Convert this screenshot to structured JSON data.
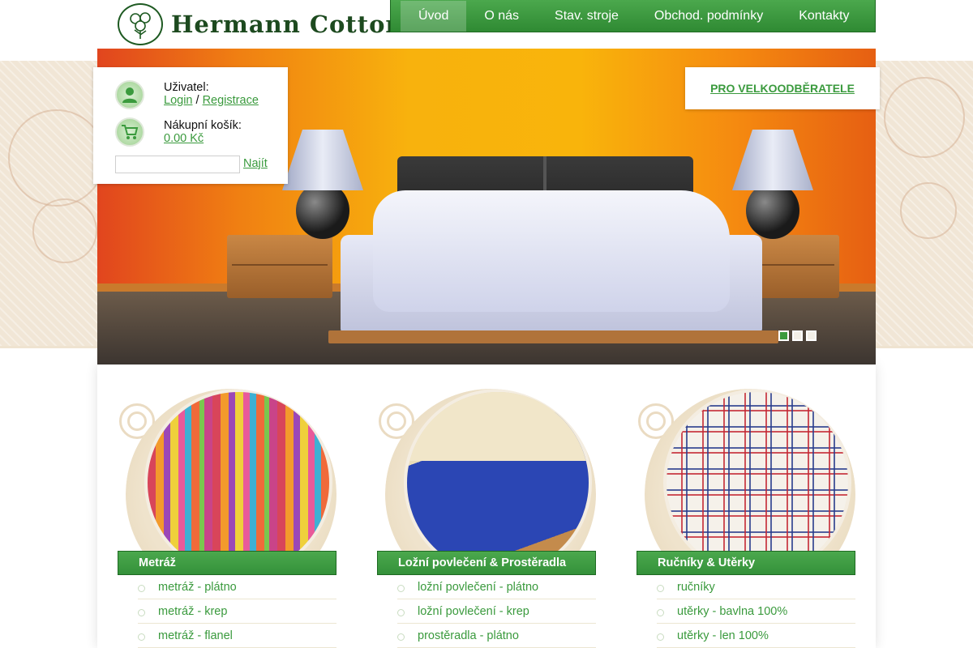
{
  "brand": {
    "name": "Hermann Cotton",
    "logo_icon": "cotton-flower-icon"
  },
  "nav": {
    "items": [
      {
        "label": "Úvod",
        "active": true
      },
      {
        "label": "O nás",
        "active": false
      },
      {
        "label": "Stav. stroje",
        "active": false
      },
      {
        "label": "Obchod. podmínky",
        "active": false
      },
      {
        "label": "Kontakty",
        "active": false
      }
    ]
  },
  "user_panel": {
    "user_label": "Uživatel:",
    "login": "Login",
    "separator": "/",
    "register": "Registrace",
    "cart_label": "Nákupní košík:",
    "cart_total": "0.00 Kč",
    "search_placeholder": "",
    "search_button": "Najít"
  },
  "wholesale": {
    "label": "PRO VELKOODBĚRATELE"
  },
  "slider": {
    "slide_count": 3,
    "active_index": 0
  },
  "categories": [
    {
      "title": "Metráž",
      "items": [
        "metráž - plátno",
        "metráž - krep",
        "metráž - flanel"
      ]
    },
    {
      "title": "Ložní povlečení & Prostěradla",
      "items": [
        "ložní povlečení - plátno",
        "ložní povlečení - krep",
        "prostěradla - plátno"
      ]
    },
    {
      "title": "Ručníky & Utěrky",
      "items": [
        "ručníky",
        "utěrky - bavlna 100%",
        "utěrky - len 100%"
      ]
    }
  ],
  "colors": {
    "accent_green": "#3a9a3d",
    "nav_green": "#2f8a33",
    "brand_dark_green": "#1d4a1f",
    "beige_band": "#f1e6d6"
  }
}
